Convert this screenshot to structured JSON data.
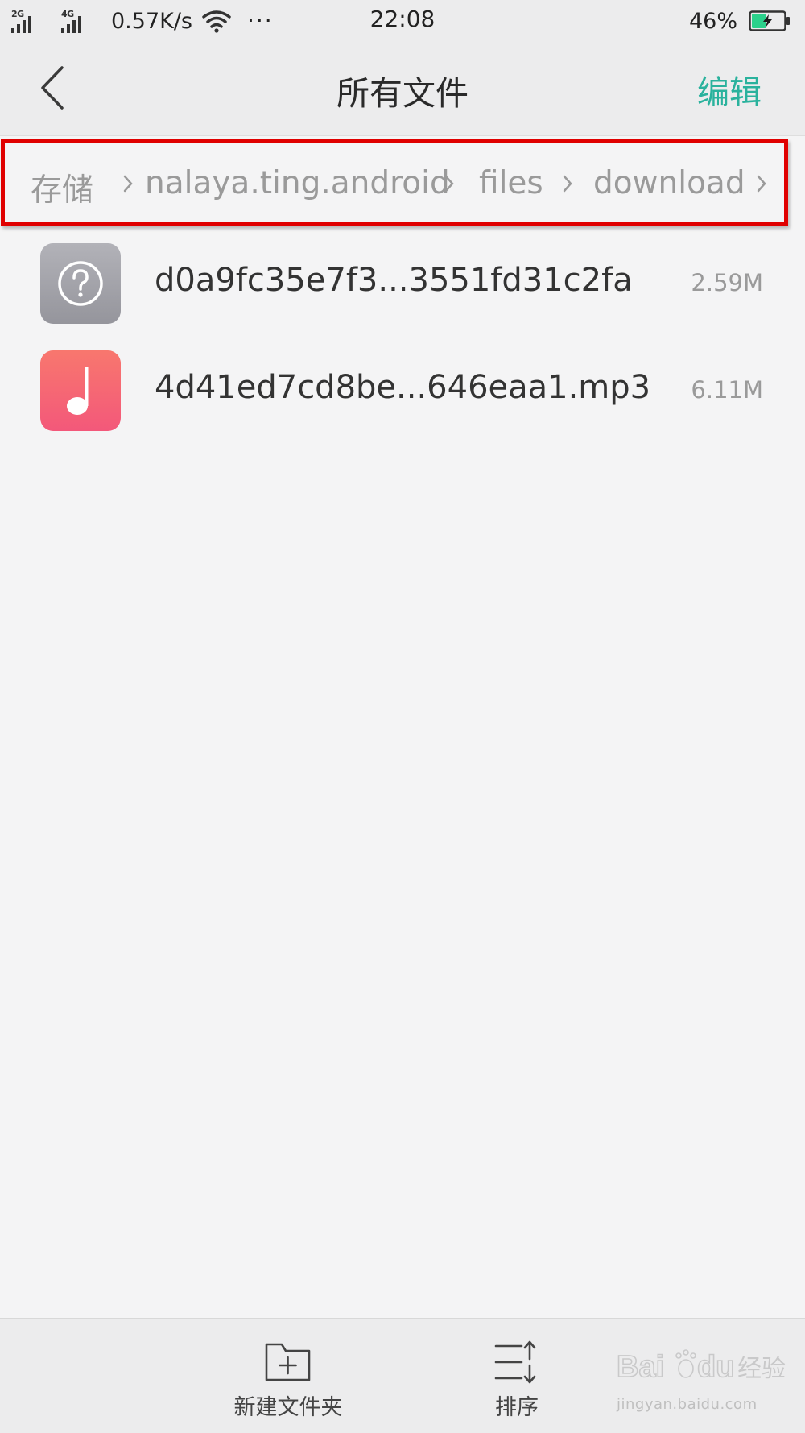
{
  "status_bar": {
    "sim1_network": "2G",
    "sim2_network": "4G",
    "net_speed": "0.57K/s",
    "more_indicator": "···",
    "time": "22:08",
    "battery_percent": "46%",
    "battery_level": 0.46,
    "battery_color": "#2bd18b",
    "charging": true
  },
  "nav": {
    "title": "所有文件",
    "edit_label": "编辑",
    "accent_color": "#2ab29d"
  },
  "breadcrumb": {
    "items": [
      {
        "label": "存储"
      },
      {
        "label": "nalaya.ting.android"
      },
      {
        "label": "files"
      },
      {
        "label": "download"
      }
    ],
    "separator_icon": "chevron-right-icon",
    "highlight_color": "#e00000"
  },
  "files": [
    {
      "name": "d0a9fc35e7f3...3551fd31c2fa",
      "size": "2.59M",
      "icon": "unknown-file-icon"
    },
    {
      "name": "4d41ed7cd8be...646eaa1.mp3",
      "size": "6.11M",
      "icon": "music-file-icon"
    }
  ],
  "toolbar": {
    "new_folder_label": "新建文件夹",
    "sort_label": "排序"
  },
  "watermark": {
    "brand": "Bai du",
    "brand_cn": "经验",
    "url": "jingyan.baidu.com"
  }
}
